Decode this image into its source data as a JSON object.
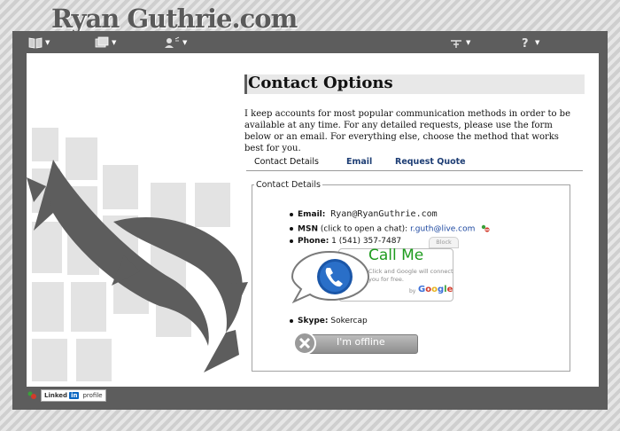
{
  "site": {
    "title": "Ryan Guthrie.com"
  },
  "nav": [
    {
      "icon": "book-icon"
    },
    {
      "icon": "photos-icon"
    },
    {
      "icon": "user-icon"
    },
    {
      "icon": "antenna-icon"
    },
    {
      "icon": "help-icon"
    }
  ],
  "page": {
    "heading": "Contact Options",
    "intro": "I keep accounts for most popular communication methods in order to be available at any time. For any detailed requests, please use the form below or an email. For everything else, choose the method that works best for you."
  },
  "tabs": [
    {
      "label": "Contact Details",
      "active": true
    },
    {
      "label": "Email",
      "active": false
    },
    {
      "label": "Request Quote",
      "active": false
    }
  ],
  "details": {
    "legend": "Contact Details",
    "email_label": "Email:",
    "email_value": "Ryan@RyanGuthrie.com",
    "msn_label": "MSN",
    "msn_note": "(click to open a chat):",
    "msn_value": "r.guth@live.com",
    "phone_label": "Phone:",
    "phone_value": "1 (541) 357-7487",
    "skype_label": "Skype:",
    "skype_value": "Sokercap"
  },
  "callme": {
    "title": "Call Me",
    "text": "Click and Google will connect you for free.",
    "by": "by",
    "google": "Google",
    "block": "Block"
  },
  "skype_status": {
    "label": "I'm offline"
  },
  "footer": {
    "linkedin_brand": "Linked",
    "linkedin_in": "in",
    "linkedin_label": "profile"
  },
  "colors": {
    "frame": "#5d5d5d",
    "accent_link": "#1d3d74",
    "callme_green": "#1d9b1d"
  }
}
